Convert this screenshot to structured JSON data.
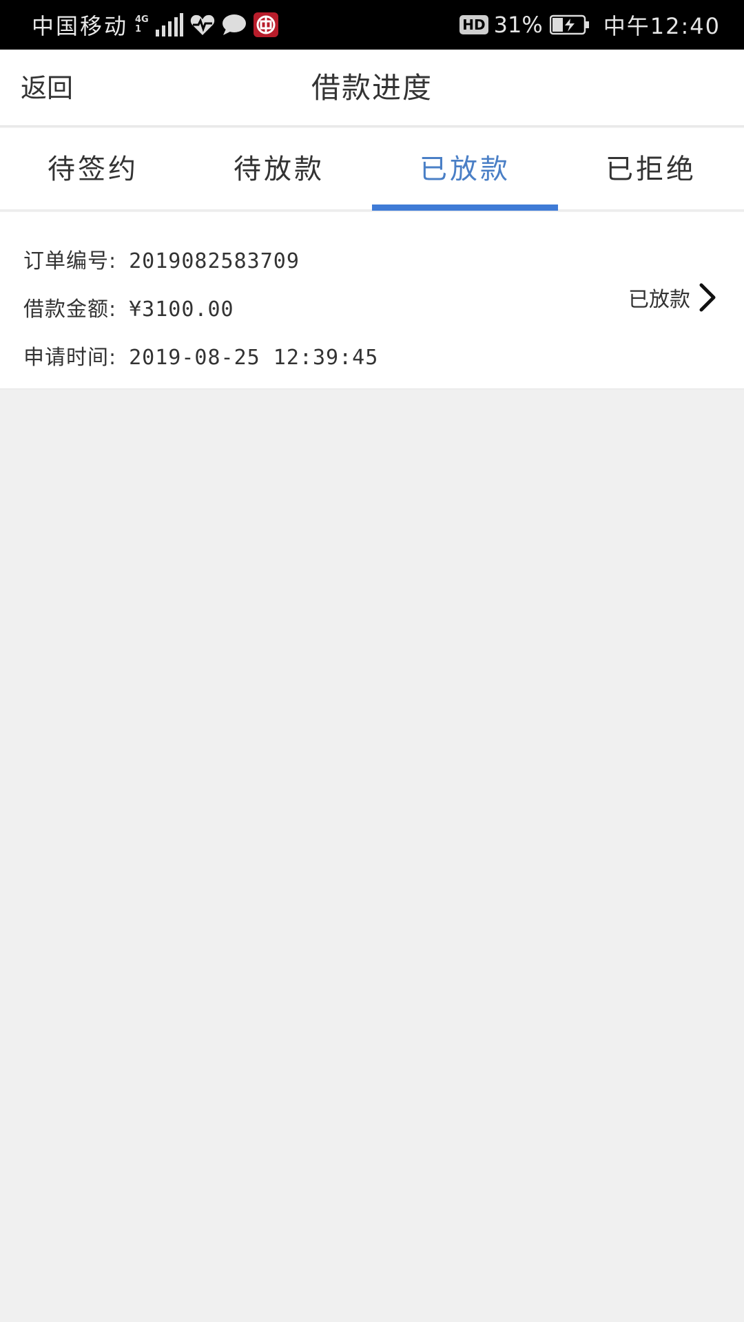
{
  "status_bar": {
    "carrier": "中国移动",
    "network_top": "4G",
    "network_bottom": "1",
    "hd": "HD",
    "battery": "31%",
    "time": "中午12:40"
  },
  "nav": {
    "back_label": "返回",
    "title": "借款进度"
  },
  "tabs": [
    {
      "label": "待签约"
    },
    {
      "label": "待放款"
    },
    {
      "label": "已放款"
    },
    {
      "label": "已拒绝"
    }
  ],
  "active_tab": 2,
  "order": {
    "number_label": "订单编号:",
    "number": "2019082583709",
    "amount_label": "借款金额:",
    "amount": "¥3100.00",
    "time_label": "申请时间:",
    "time": "2019-08-25 12:39:45",
    "status": "已放款"
  },
  "colors": {
    "accent": "#3f7bd6",
    "active_text": "#4a7fc6",
    "background": "#f0f0f0"
  }
}
